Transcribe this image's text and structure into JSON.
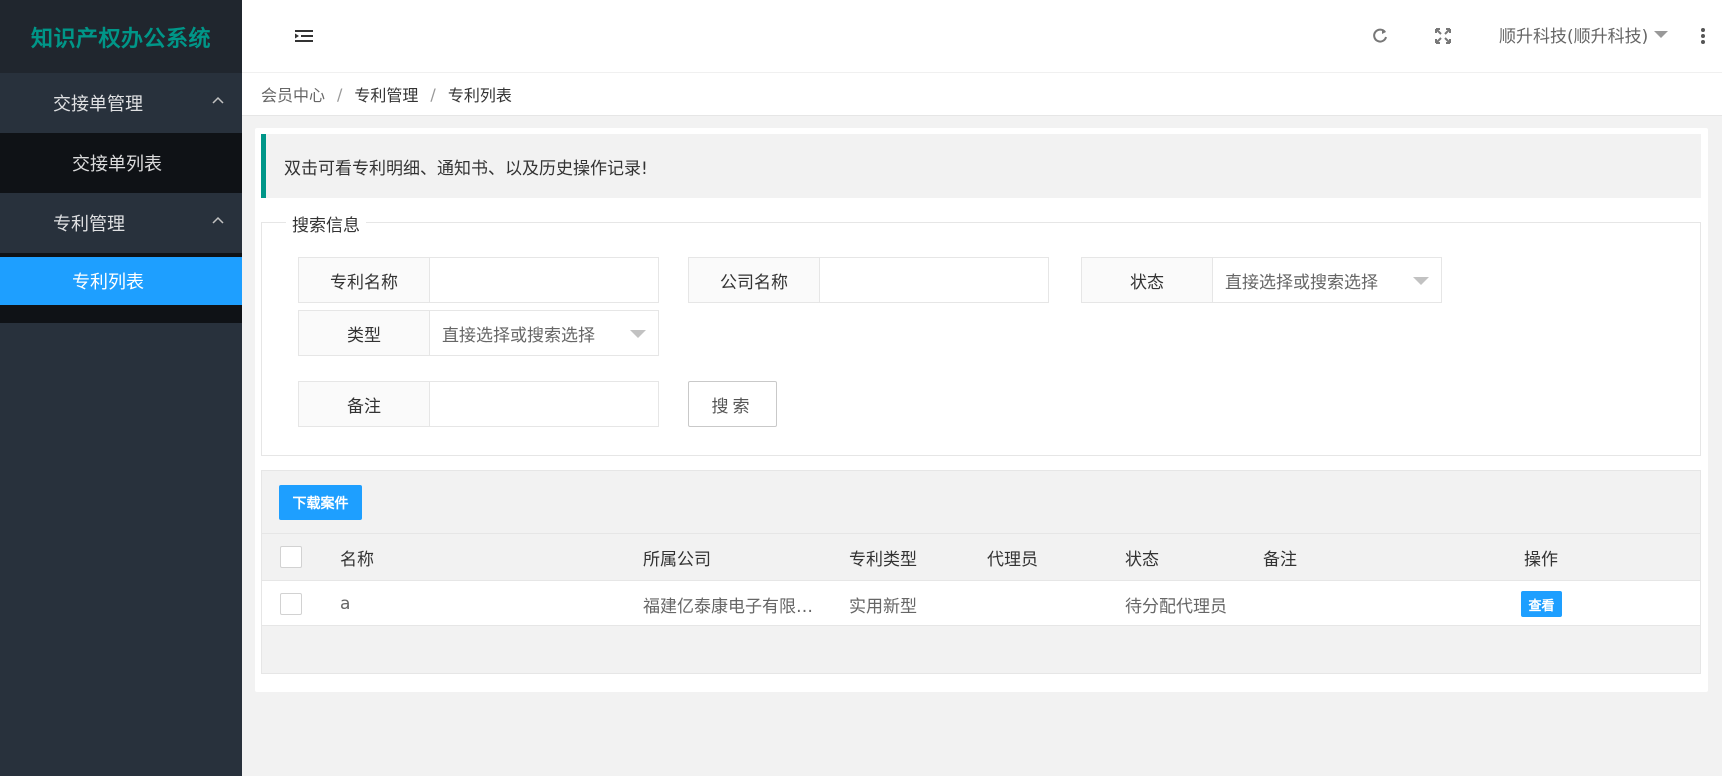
{
  "app": {
    "title": "知识产权办公系统"
  },
  "sidebar": {
    "groups": [
      {
        "label": "交接单管理",
        "items": [
          {
            "label": "交接单列表"
          }
        ]
      },
      {
        "label": "专利管理",
        "items": [
          {
            "label": "专利列表"
          }
        ]
      }
    ]
  },
  "header": {
    "user": "顺升科技(顺升科技)"
  },
  "breadcrumb": [
    "会员中心",
    "专利管理",
    "专利列表"
  ],
  "breadcrumb_sep": "/",
  "tip": "双击可看专利明细、通知书、以及历史操作记录!",
  "search": {
    "legend": "搜索信息",
    "fields": {
      "name": {
        "label": "专利名称",
        "value": ""
      },
      "company": {
        "label": "公司名称",
        "value": ""
      },
      "status": {
        "label": "状态",
        "value": "直接选择或搜索选择"
      },
      "type": {
        "label": "类型",
        "value": "直接选择或搜索选择"
      },
      "remark": {
        "label": "备注",
        "value": ""
      }
    },
    "button": "搜索"
  },
  "table": {
    "download_button": "下载案件",
    "columns": [
      "名称",
      "所属公司",
      "专利类型",
      "代理员",
      "状态",
      "备注",
      "操作"
    ],
    "rows": [
      {
        "name": "a",
        "company": "福建亿泰康电子有限…",
        "type": "实用新型",
        "agent": "",
        "status": "待分配代理员",
        "remark": "",
        "action": "查看"
      }
    ]
  },
  "colors": {
    "accent": "#009688",
    "primary": "#1e9fff",
    "sidebar": "#28313c"
  }
}
